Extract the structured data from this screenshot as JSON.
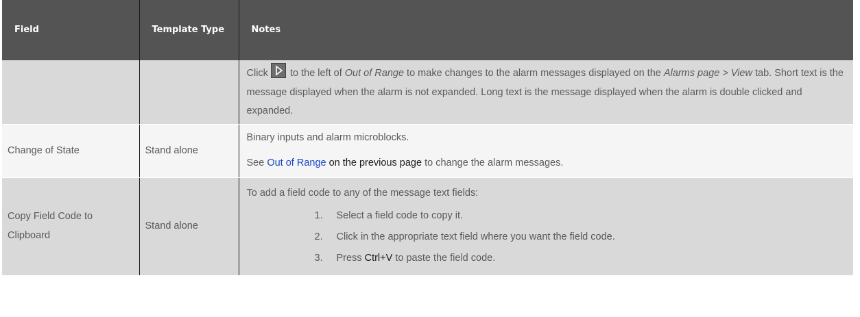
{
  "headers": {
    "field": "Field",
    "template_type": "Template Type",
    "notes": "Notes"
  },
  "row1": {
    "field": "",
    "template": "",
    "notes": {
      "click": "Click",
      "to_left_of": " to the left of ",
      "out_of_range": "Out of Range",
      "make_changes": " to make changes to the alarm messages displayed on the ",
      "alarms_page": "Alarms page > View",
      "rest": " tab. Short text is the message displayed when the alarm is not expanded. Long text is the message displayed when the alarm is double clicked and expanded."
    }
  },
  "row2": {
    "field": "Change of State",
    "template": "Stand alone",
    "notes": {
      "line1": "Binary inputs and alarm microblocks.",
      "see": "See ",
      "link": "Out of Range",
      "prev_page": " on the previous page",
      "rest": " to change the alarm messages."
    }
  },
  "row3": {
    "field": "Copy Field Code to Clipboard",
    "template": "Stand alone",
    "notes": {
      "intro": "To add a field code to any of the message text fields:",
      "steps": [
        {
          "num": "1.",
          "text": "Select a field code to copy it."
        },
        {
          "num": "2.",
          "text": "Click in the appropriate text field where you want the field code."
        },
        {
          "num": "3.",
          "pre": "Press ",
          "key": "Ctrl+V",
          "post": " to paste the field code."
        }
      ]
    }
  }
}
